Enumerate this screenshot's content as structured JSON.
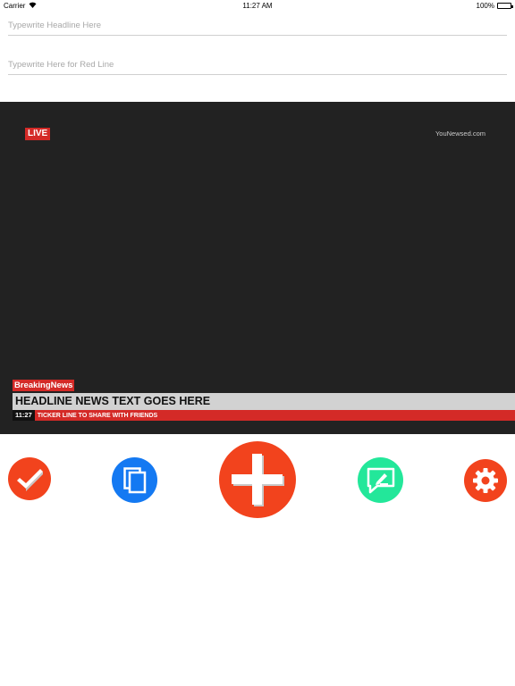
{
  "status_bar": {
    "carrier": "Carrier",
    "time": "11:27 AM",
    "battery": "100%",
    "battery_level": 1.0
  },
  "inputs": {
    "headline_placeholder": "Typewrite Headline Here",
    "redline_placeholder": "Typewrite Here for Red Line"
  },
  "preview": {
    "live_label": "LIVE",
    "brand": "YouNewsed.com",
    "breaking_label": "BreakingNews",
    "headline": "HEADLINE NEWS TEXT GOES HERE",
    "ticker_time": "11:27",
    "ticker_text": "TICKER LINE TO SHARE WITH FRIENDS"
  },
  "toolbar": {
    "buttons": [
      {
        "icon": "check-icon",
        "color": "#f2431d"
      },
      {
        "icon": "copy-icon",
        "color": "#1479f2"
      },
      {
        "icon": "plus-icon",
        "color": "#f2431d"
      },
      {
        "icon": "chat-edit-icon",
        "color": "#23e79a"
      },
      {
        "icon": "gear-icon",
        "color": "#f2431d"
      }
    ]
  },
  "colors": {
    "accent_red": "#d42a27",
    "preview_background": "#222222",
    "headline_bar": "#d2d2d2"
  }
}
